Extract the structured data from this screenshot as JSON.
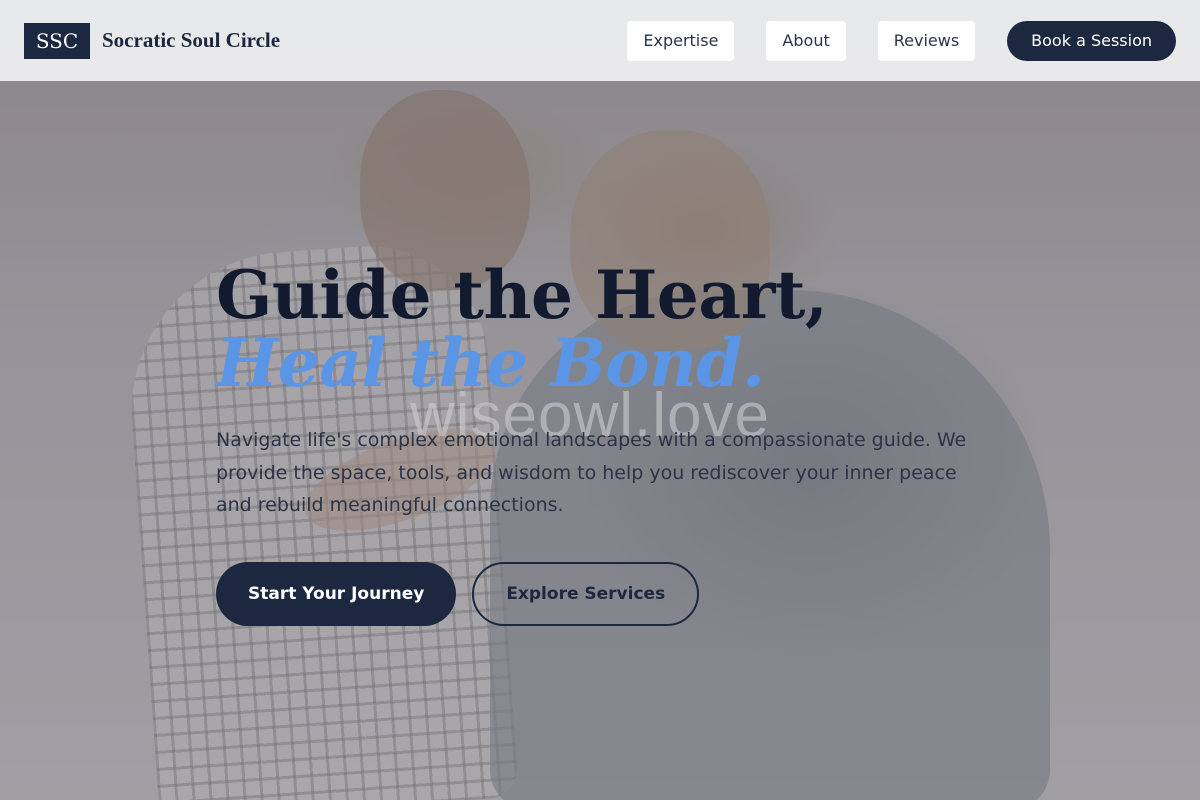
{
  "header": {
    "logo_text": "SSC",
    "brand_name": "Socratic Soul Circle",
    "nav": [
      "Expertise",
      "About",
      "Reviews"
    ],
    "cta_label": "Book a Session"
  },
  "hero": {
    "headline_line1": "Guide the Heart,",
    "headline_line2": "Heal the Bond.",
    "description": "Navigate life's complex emotional landscapes with a compassionate guide. We provide the space, tools, and wisdom to help you rediscover your inner peace and rebuild meaningful connections.",
    "primary_button": "Start Your Journey",
    "secondary_button": "Explore Services",
    "watermark": "wiseowl.love"
  },
  "colors": {
    "navy": "#1c2740",
    "accent_blue": "#5b95e6",
    "header_bg": "#ecedef"
  }
}
